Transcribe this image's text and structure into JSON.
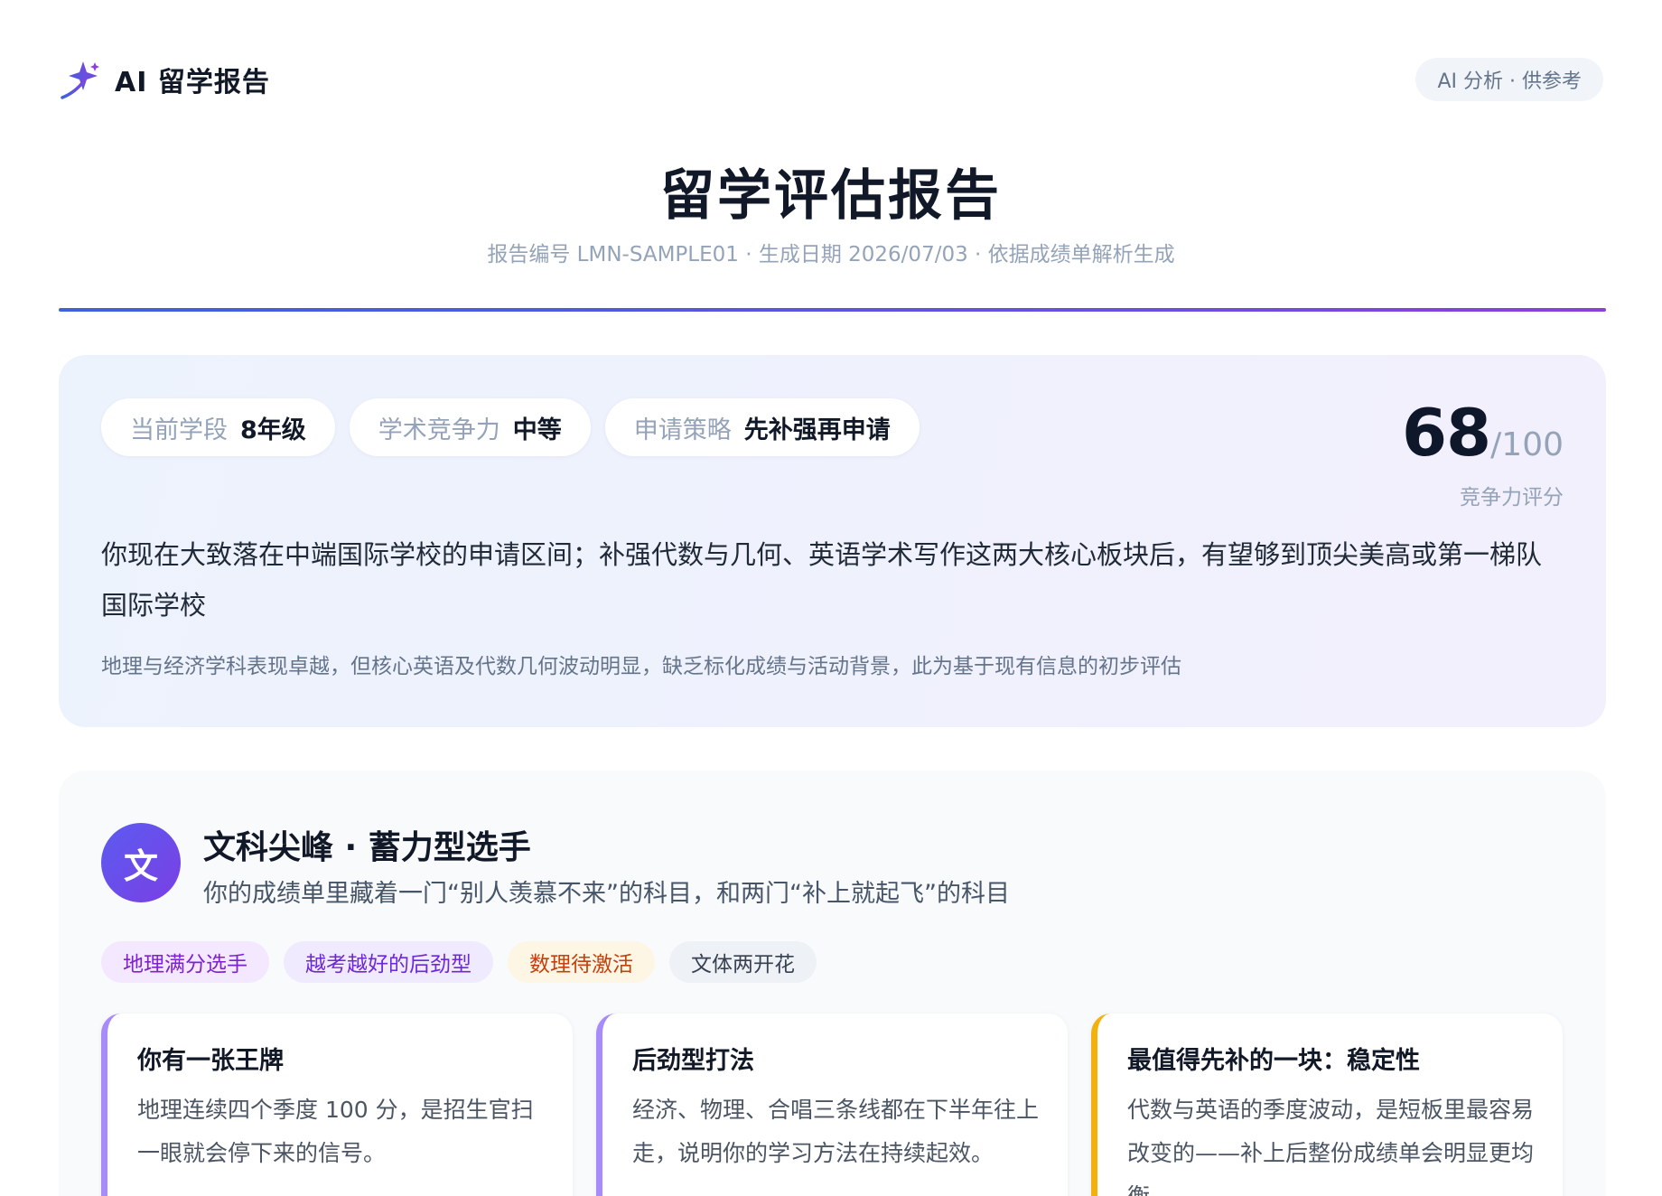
{
  "header": {
    "brand": "AI 留学报告",
    "badge": "AI 分析 · 供参考"
  },
  "report": {
    "title": "留学评估报告",
    "meta": "报告编号 LMN-SAMPLE01 · 生成日期 2026/07/03 · 依据成绩单解析生成"
  },
  "summary": {
    "tags": [
      {
        "label": "当前学段",
        "value": "8年级"
      },
      {
        "label": "学术竞争力",
        "value": "中等"
      },
      {
        "label": "申请策略",
        "value": "先补强再申请"
      }
    ],
    "score": {
      "value": "68",
      "max": "/100",
      "label": "竞争力评分"
    },
    "main_text": "你现在大致落在中端国际学校的申请区间；补强代数与几何、英语学术写作这两大核心板块后，有望够到顶尖美高或第一梯队国际学校",
    "sub_text": "地理与经济学科表现卓越，但核心英语及代数几何波动明显，缺乏标化成绩与活动背景，此为基于现有信息的初步评估"
  },
  "profile": {
    "avatar_char": "文",
    "title": "文科尖峰 · 蓄力型选手",
    "subtitle": "你的成绩单里藏着一门“别人羡慕不来”的科目，和两门“补上就起飞”的科目",
    "chips": [
      "地理满分选手",
      "越考越好的后劲型",
      "数理待激活",
      "文体两开花"
    ],
    "cards": [
      {
        "title": "你有一张王牌",
        "body": "地理连续四个季度 100 分，是招生官扫一眼就会停下来的信号。"
      },
      {
        "title": "后劲型打法",
        "body": "经济、物理、合唱三条线都在下半年往上走，说明你的学习方法在持续起效。"
      },
      {
        "title": "最值得先补的一块：稳定性",
        "body": "代数与英语的季度波动，是短板里最容易改变的——补上后整份成绩单会明显更均衡。"
      }
    ]
  },
  "colors": {
    "accent_gradient_start": "#3b63dc",
    "accent_gradient_end": "#8d3fd8",
    "card_accent_purple": "#a78bfa",
    "card_accent_amber": "#f5b10b"
  }
}
